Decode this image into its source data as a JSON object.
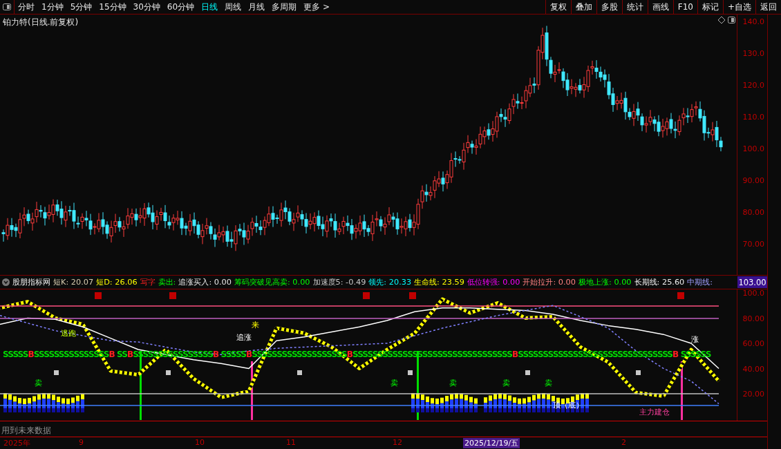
{
  "toolbar": {
    "periods": [
      {
        "label": "分时",
        "selected": false
      },
      {
        "label": "1分钟",
        "selected": false
      },
      {
        "label": "5分钟",
        "selected": false
      },
      {
        "label": "15分钟",
        "selected": false
      },
      {
        "label": "30分钟",
        "selected": false
      },
      {
        "label": "60分钟",
        "selected": false
      },
      {
        "label": "日线",
        "selected": true
      },
      {
        "label": "周线",
        "selected": false
      },
      {
        "label": "月线",
        "selected": false
      },
      {
        "label": "多周期",
        "selected": false
      },
      {
        "label": "更多 >",
        "selected": false
      }
    ],
    "actions": [
      "复权",
      "叠加",
      "多股",
      "统计",
      "画线",
      "F10",
      "标记",
      "+自选",
      "返回"
    ]
  },
  "title": "铂力特(日线.前复权)",
  "price_axis": [
    "140.0",
    "130.0",
    "120.0",
    "110.0",
    "100.0",
    "90.00",
    "80.00",
    "70.00"
  ],
  "indicator": {
    "name": "股朋指标网",
    "values": [
      "短K: 20.07",
      "短D: 26.06",
      "写字",
      "卖出:",
      "追涨买入: 0.00",
      "筹码突破见高卖: 0.00",
      "加速度5: -0.49",
      "领先: 20.33",
      "生命线: 23.59",
      "低位转强: 0.00",
      "开始拉升: 0.00",
      "极地上涨: 0.00",
      "长期线: 25.60",
      "中期线:"
    ],
    "price_tag": "103.00",
    "annotations": [
      "逃跑",
      "来",
      "追涨",
      "涨",
      "卖",
      "卖",
      "卖",
      "卖",
      "卖",
      "顶（底）",
      "主力建仓"
    ],
    "signal_row": [
      {
        "text": "SSSSS",
        "kind": "sell"
      },
      {
        "text": "B",
        "kind": "buy"
      },
      {
        "text": "SSSSSSSSSSSSSSS",
        "kind": "sell"
      },
      {
        "text": "B",
        "kind": "buy"
      },
      {
        "text": " SS",
        "kind": "sell"
      },
      {
        "text": "B",
        "kind": "buy"
      },
      {
        "text": "SSSSSSSSSSSSSSSS",
        "kind": "sell"
      },
      {
        "text": "B",
        "kind": "buy"
      },
      {
        "text": " SSSSS",
        "kind": "sell"
      },
      {
        "text": "B",
        "kind": "buy"
      },
      {
        "text": "SSSSSSSSSSSSSSSSSSS",
        "kind": "sell"
      },
      {
        "text": "B",
        "kind": "buy"
      },
      {
        "text": "SSSSSSSSSSSSSSSSSSSSSSSSSSSSSSSS",
        "kind": "sell"
      },
      {
        "text": "B",
        "kind": "buy"
      },
      {
        "text": "SSSSSSSSSSSSSSSSSSSSSSSSSSSSSSS",
        "kind": "sell"
      },
      {
        "text": "B",
        "kind": "buy"
      },
      {
        "text": " SSSSSS",
        "kind": "sell"
      }
    ],
    "chart_data": {
      "type": "line",
      "ylim": [
        -1.4,
        102.7
      ],
      "yticks": [
        {
          "value": 100,
          "label": "100.0"
        },
        {
          "value": 80,
          "label": "80.00"
        },
        {
          "value": 60,
          "label": "60.00"
        },
        {
          "value": 40,
          "label": "40.00"
        },
        {
          "value": 20,
          "label": "20.00"
        }
      ],
      "series": [
        {
          "color": "#ffff00",
          "values": [
            88,
            93,
            80,
            75,
            38,
            35,
            55,
            32,
            17,
            22,
            72,
            68,
            57,
            40,
            55,
            68,
            95,
            84,
            92,
            80,
            81,
            57,
            45,
            21,
            18,
            55,
            30
          ]
        },
        {
          "color": "#ffffff",
          "values": [
            75,
            80,
            79,
            73,
            64,
            55,
            51,
            47,
            44,
            40,
            62,
            65,
            69,
            73,
            78,
            85,
            88,
            88,
            87,
            86,
            83,
            78,
            74,
            71,
            67,
            60,
            40
          ]
        },
        {
          "color": "#ff5080",
          "values": [
            89.6,
            89.6,
            89.6,
            89.6,
            89.6,
            89.6,
            89.6,
            89.6,
            89.6,
            89.6,
            89.6,
            89.6,
            89.6,
            89.6,
            89.6,
            89.6,
            89.6,
            89.6,
            89.6,
            89.6,
            89.6,
            89.6,
            89.6,
            89.6,
            89.6,
            89.6,
            89.6
          ]
        },
        {
          "color": "#c060c0",
          "values": [
            79.7,
            79.7,
            79.7,
            79.7,
            79.7,
            79.7,
            79.7,
            79.7,
            79.7,
            79.7,
            79.7,
            79.7,
            79.7,
            79.7,
            79.7,
            79.7,
            79.7,
            79.7,
            79.7,
            79.7,
            79.7,
            79.7,
            79.7,
            79.7,
            79.7,
            79.7,
            79.7
          ]
        },
        {
          "color": "#c0c0c0",
          "values": [
            20,
            20,
            20,
            20,
            20,
            20,
            20,
            20,
            20,
            20,
            20,
            20,
            20,
            20,
            20,
            20,
            20,
            20,
            20,
            20,
            20,
            20,
            20,
            20,
            20,
            20,
            20
          ]
        },
        {
          "color": "#4080ff",
          "values": [
            10.7,
            10.7,
            10.7,
            10.7,
            10.7,
            10.7,
            10.7,
            10.7,
            10.7,
            10.7,
            10.7,
            10.7,
            10.7,
            10.7,
            10.7,
            10.7,
            10.7,
            10.7,
            10.7,
            10.7,
            10.7,
            10.7,
            10.7,
            10.7,
            10.7,
            10.7,
            10.7
          ]
        },
        {
          "color": "#8080ff",
          "line_style": "dashed",
          "values": [
            82,
            76,
            70,
            66,
            62,
            61,
            57,
            53,
            51,
            54,
            56,
            57,
            58,
            59,
            60,
            66,
            72,
            77,
            82,
            86,
            90,
            81,
            72,
            54,
            40,
            30,
            12
          ]
        }
      ]
    }
  },
  "status": "用到未来数据",
  "date_axis": [
    {
      "label": "2025年",
      "selected": false
    },
    {
      "label": "9",
      "selected": false
    },
    {
      "label": "10",
      "selected": false
    },
    {
      "label": "11",
      "selected": false
    },
    {
      "label": "12",
      "selected": false
    },
    {
      "label": "2025/12/19/五",
      "selected": true
    },
    {
      "label": "2",
      "selected": false
    }
  ]
}
